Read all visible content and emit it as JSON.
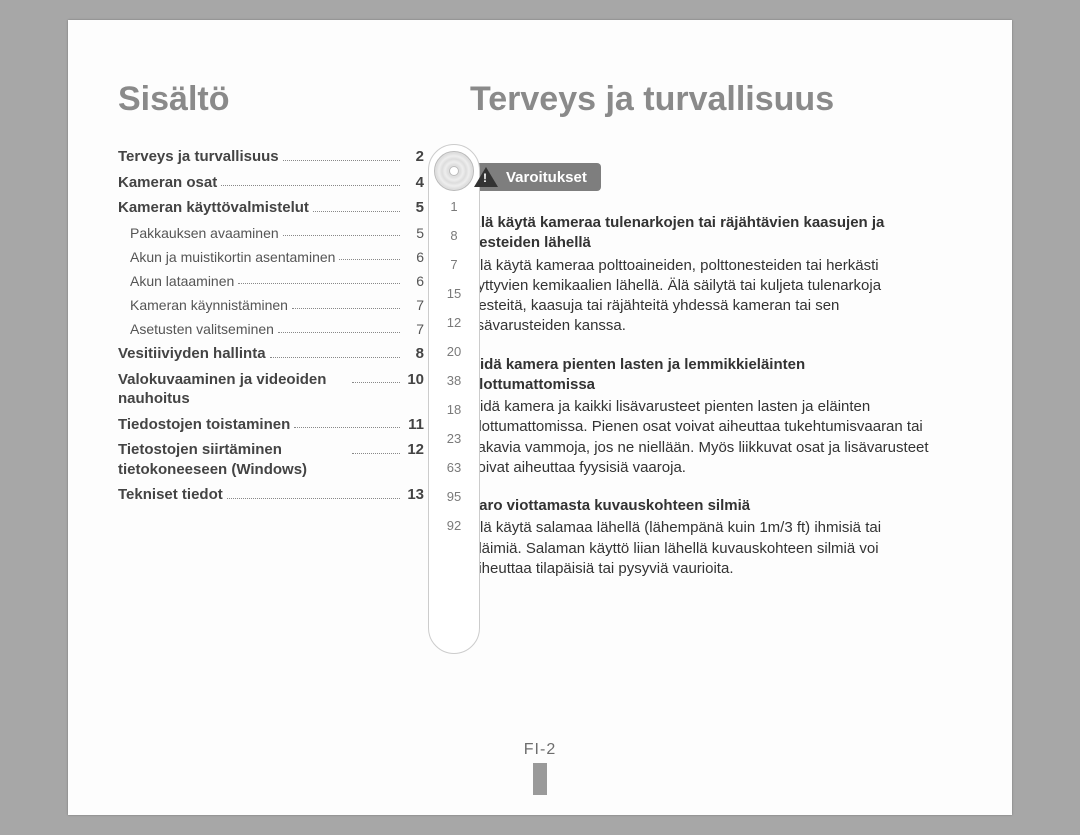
{
  "left": {
    "title": "Sisältö",
    "toc": [
      {
        "label": "Terveys ja turvallisuus",
        "page": "2",
        "bold": true
      },
      {
        "label": "Kameran osat",
        "page": "4",
        "bold": true
      },
      {
        "label": "Kameran käyttövalmistelut",
        "page": "5",
        "bold": true
      },
      {
        "label": "Pakkauksen avaaminen",
        "page": "5",
        "sub": true
      },
      {
        "label": "Akun ja muistikortin asentaminen",
        "page": "6",
        "sub": true
      },
      {
        "label": "Akun lataaminen",
        "page": "6",
        "sub": true
      },
      {
        "label": "Kameran käynnistäminen",
        "page": "7",
        "sub": true
      },
      {
        "label": "Asetusten valitseminen",
        "page": "7",
        "sub": true
      },
      {
        "label": "Vesitiiviyden hallinta",
        "page": "8",
        "bold": true
      },
      {
        "label": "Valokuvaaminen ja videoiden nauhoitus",
        "page": "10",
        "bold": true
      },
      {
        "label": "Tiedostojen toistaminen",
        "page": "11",
        "bold": true
      },
      {
        "label": "Tietostojen siirtäminen tietokoneeseen (Windows)",
        "page": "12",
        "bold": true
      },
      {
        "label": "Tekniset tiedot",
        "page": "13",
        "bold": true
      }
    ],
    "capsule": [
      "1",
      "8",
      "7",
      "15",
      "12",
      "20",
      "38",
      "18",
      "23",
      "63",
      "95",
      "92"
    ]
  },
  "right": {
    "title": "Terveys ja turvallisuus",
    "badge": "Varoitukset",
    "blocks": [
      {
        "h": "Älä käytä kameraa tulenarkojen tai räjähtävien kaasujen ja nesteiden lähellä",
        "p": "Älä käytä kameraa polttoaineiden, polttonesteiden tai herkästi syttyvien kemikaalien lähellä. Älä säilytä tai kuljeta tulenarkoja nesteitä, kaasuja tai räjähteitä yhdessä kameran tai sen lisävarusteiden kanssa."
      },
      {
        "h": "Pidä kamera pienten lasten ja lemmikkieläinten ulottumattomissa",
        "p": "Pidä kamera ja kaikki lisävarusteet pienten lasten ja eläinten ulottumattomissa. Pienen osat voivat aiheuttaa tukehtumisvaaran tai vakavia vammoja, jos ne niellään. Myös liikkuvat osat ja lisävarusteet voivat aiheuttaa fyysisiä vaaroja."
      },
      {
        "h": "Varo viottamasta kuvauskohteen silmiä",
        "p": "Älä käytä salamaa lähellä (lähempänä kuin 1m/3 ft) ihmisiä tai eläimiä. Salaman käyttö liian lähellä kuvauskohteen silmiä voi aiheuttaa tilapäisiä tai pysyviä vaurioita."
      }
    ]
  },
  "footer": "FI-2"
}
